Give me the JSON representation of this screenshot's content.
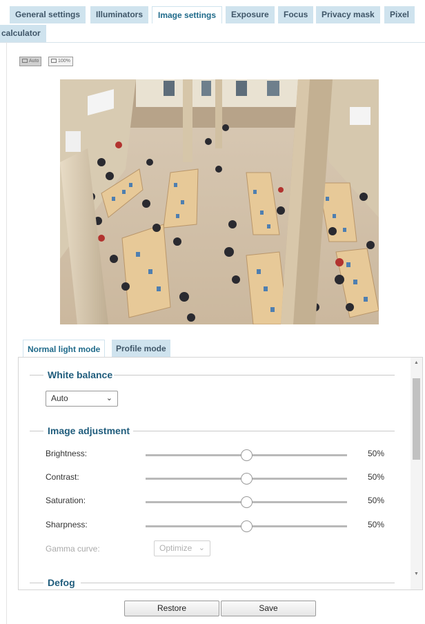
{
  "tabs": [
    {
      "label": "General settings"
    },
    {
      "label": "Illuminators"
    },
    {
      "label": "Image settings",
      "active": true
    },
    {
      "label": "Exposure"
    },
    {
      "label": "Focus"
    },
    {
      "label": "Privacy mask"
    },
    {
      "label": "Pixel"
    },
    {
      "label": "calculator"
    }
  ],
  "view_buttons": [
    {
      "label": "Auto",
      "active": true
    },
    {
      "label": "100%"
    }
  ],
  "mode_tabs": [
    {
      "label": "Normal light mode",
      "active": true
    },
    {
      "label": "Profile mode"
    }
  ],
  "white_balance": {
    "title": "White balance",
    "value": "Auto"
  },
  "image_adjustment": {
    "title": "Image adjustment",
    "rows": [
      {
        "label": "Brightness:",
        "value": "50%",
        "level": 0.5
      },
      {
        "label": "Contrast:",
        "value": "50%",
        "level": 0.5
      },
      {
        "label": "Saturation:",
        "value": "50%",
        "level": 0.5
      },
      {
        "label": "Sharpness:",
        "value": "50%",
        "level": 0.5
      }
    ],
    "gamma": {
      "label": "Gamma curve:",
      "value": "Optimize",
      "disabled": true
    }
  },
  "defog": {
    "title": "Defog"
  },
  "buttons": {
    "restore": "Restore",
    "save": "Save"
  },
  "colors": {
    "tab_bg": "#cfe3ee",
    "accent": "#1f6a8a",
    "section_title": "#1f5c7c"
  }
}
